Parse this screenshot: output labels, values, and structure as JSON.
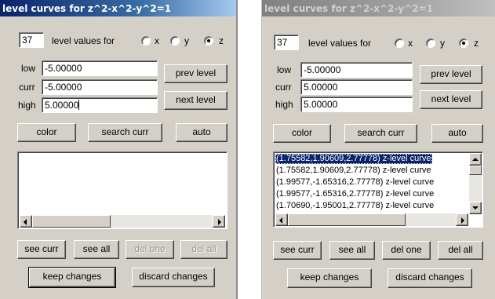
{
  "left": {
    "title": "level curves for z^2-x^2-y^2=1",
    "count_value": "37",
    "level_values_label": "level values for",
    "radio_x": "x",
    "radio_y": "y",
    "radio_z": "z",
    "selected_axis": "z",
    "low_label": "low",
    "low_value": "-5.00000",
    "curr_label": "curr",
    "curr_value": "-5.00000",
    "high_label": "high",
    "high_value": "5.00000",
    "prev_level": "prev level",
    "next_level": "next level",
    "color": "color",
    "search_curr": "search curr",
    "auto": "auto",
    "see_curr": "see curr",
    "see_all": "see all",
    "del_one": "del one",
    "del_all": "del all",
    "keep_changes": "keep changes",
    "discard_changes": "discard changes"
  },
  "right": {
    "title": "level curves for z^2-x^2-y^2=1",
    "count_value": "37",
    "level_values_label": "level values for",
    "radio_x": "x",
    "radio_y": "y",
    "radio_z": "z",
    "selected_axis": "z",
    "low_label": "low",
    "low_value": "-5.00000",
    "curr_label": "curr",
    "curr_value": "5.00000",
    "high_label": "high",
    "high_value": "5.00000",
    "prev_level": "prev level",
    "next_level": "next level",
    "color": "color",
    "search_curr": "search curr",
    "auto": "auto",
    "list_items": [
      "(1.75582,1.90609,2.77778) z-level curve",
      "(1.75582,1.90609,2.77778) z-level curve",
      "(1.99577,-1.65316,2.77778) z-level curve",
      "(1.99577,-1.65316,2.77778) z-level curve",
      "(1.70690,-1.95001,2.77778) z-level curve"
    ],
    "see_curr": "see curr",
    "see_all": "see all",
    "del_one": "del one",
    "del_all": "del all",
    "keep_changes": "keep changes",
    "discard_changes": "discard changes"
  },
  "colors": {
    "window_bg": "#d4d0c8",
    "title_active": "#0a246a",
    "title_inactive": "#808080",
    "selection": "#0a246a"
  }
}
